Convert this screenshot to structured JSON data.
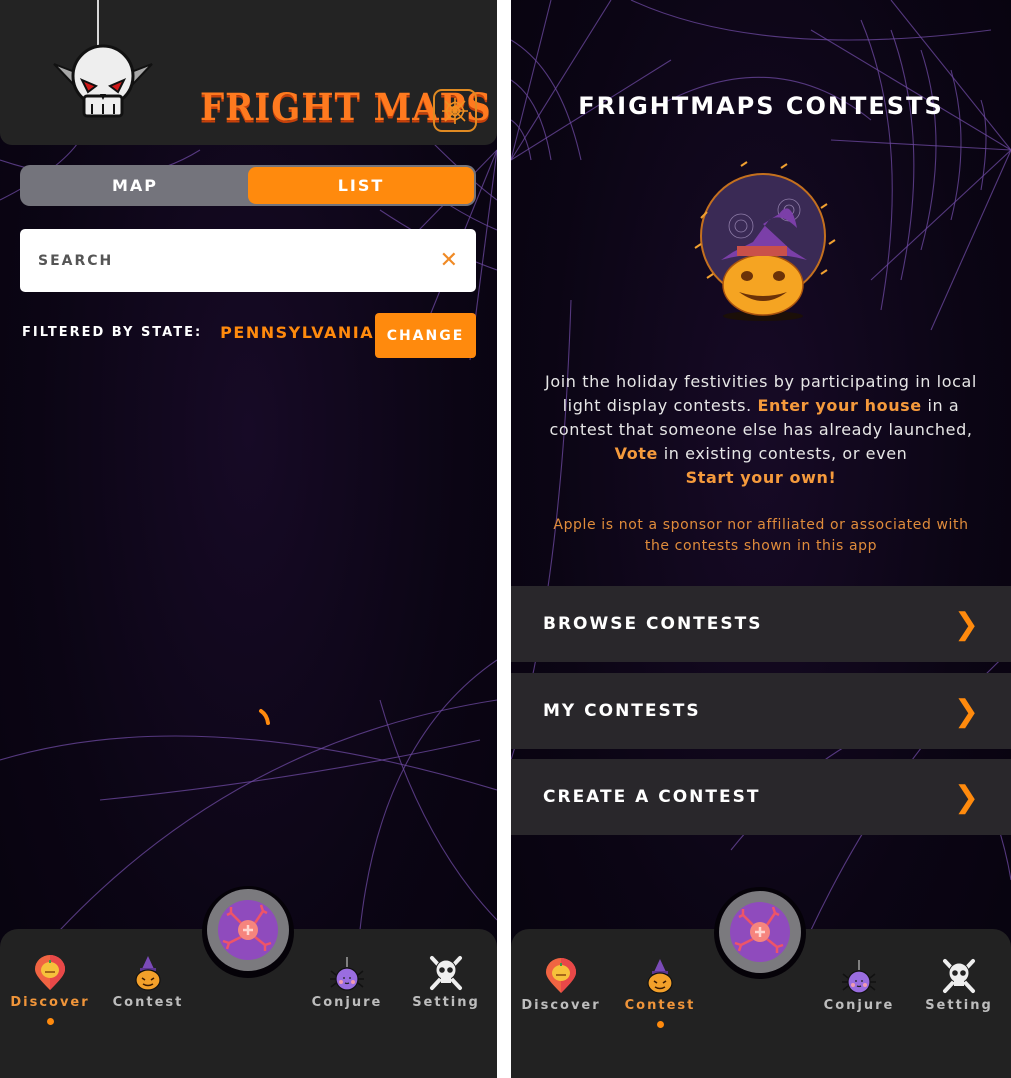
{
  "left_screen": {
    "header": {
      "app_title": "FRIGHT MAPS",
      "web_button_icon": "spider-web-icon",
      "mascot_icon": "vampire-skull-icon"
    },
    "view_toggle": {
      "options": [
        "MAP",
        "LIST"
      ],
      "selected": "LIST"
    },
    "search": {
      "placeholder": "SEARCH",
      "value": "",
      "clear_icon": "close-icon"
    },
    "filter": {
      "label": "FILTERED BY STATE:",
      "value": "PENNSYLVANIA",
      "change_button": "CHANGE"
    },
    "status": {
      "loading": true
    }
  },
  "right_screen": {
    "title": "FRIGHTMAPS CONTESTS",
    "intro": {
      "part1": "Join the holiday festivities by participating in local light display contests.",
      "highlight1": "Enter your house",
      "part2": "in a contest that someone else has already launched,",
      "highlight2": "Vote",
      "part3": "in existing contests, or even",
      "highlight3": "Start your own!"
    },
    "disclaimer": "Apple is not a sponsor nor affiliated or associated with the contests shown in this app",
    "menu": [
      {
        "label": "BROWSE CONTESTS",
        "icon": "chevron-right-icon"
      },
      {
        "label": "MY CONTESTS",
        "icon": "chevron-right-icon"
      },
      {
        "label": "CREATE A CONTEST",
        "icon": "chevron-right-icon"
      }
    ]
  },
  "tabbar": {
    "tabs": [
      {
        "label": "Discover",
        "icon": "pumpkin-pin-icon"
      },
      {
        "label": "Contest",
        "icon": "witch-pumpkin-icon"
      },
      {
        "label": "Conjure",
        "icon": "spider-icon"
      },
      {
        "label": "Setting",
        "icon": "skull-crossbones-icon"
      }
    ],
    "center_button_icon": "eyeball-plus-icon",
    "left_active": "Discover",
    "right_active": "Contest"
  },
  "colors": {
    "accent": "#ff8a0d",
    "header_bg": "#232323",
    "tabbar_bg": "#222222",
    "web": "#6d4aa2"
  }
}
